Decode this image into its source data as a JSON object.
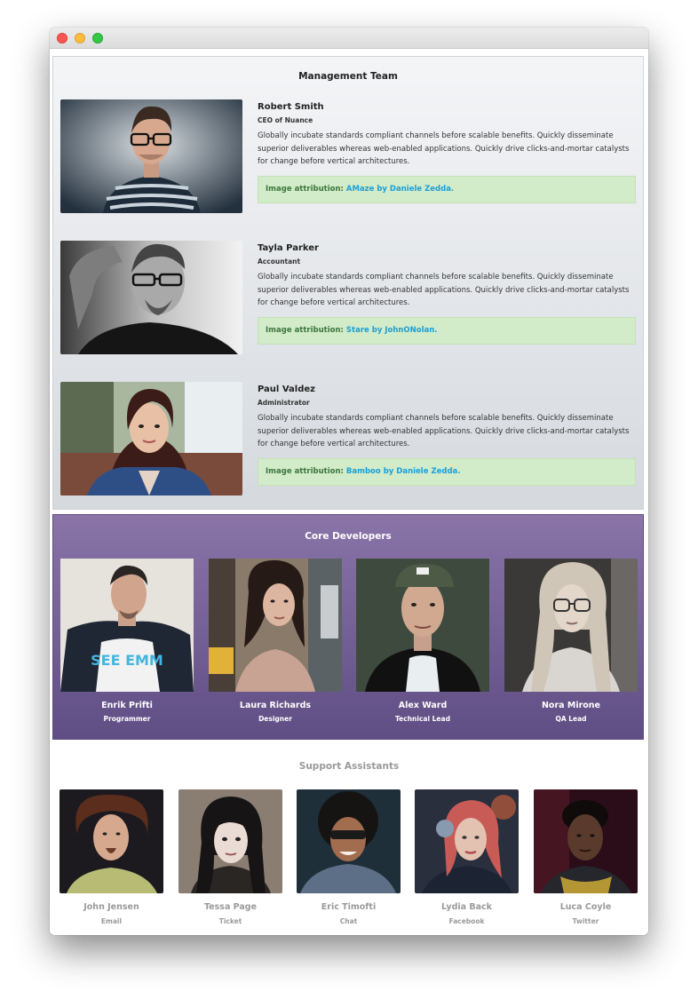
{
  "management": {
    "title": "Management Team",
    "members": [
      {
        "name": "Robert Smith",
        "role": "CEO of Nuance",
        "bio": "Globally incubate standards compliant channels before scalable benefits. Quickly disseminate superior deliverables whereas web-enabled applications. Quickly drive clicks-and-mortar catalysts for change before vertical architectures.",
        "attribution_label": "Image attribution:",
        "attribution_link": "AMaze by Daniele Zedda."
      },
      {
        "name": "Tayla Parker",
        "role": "Accountant",
        "bio": "Globally incubate standards compliant channels before scalable benefits. Quickly disseminate superior deliverables whereas web-enabled applications. Quickly drive clicks-and-mortar catalysts for change before vertical architectures.",
        "attribution_label": "Image attribution:",
        "attribution_link": "Stare by JohnONolan."
      },
      {
        "name": "Paul Valdez",
        "role": "Administrator",
        "bio": "Globally incubate standards compliant channels before scalable benefits. Quickly disseminate superior deliverables whereas web-enabled applications. Quickly drive clicks-and-mortar catalysts for change before vertical architectures.",
        "attribution_label": "Image attribution:",
        "attribution_link": "Bamboo by Daniele Zedda."
      }
    ]
  },
  "core": {
    "title": "Core Developers",
    "members": [
      {
        "name": "Enrik Prifti",
        "role": "Programmer",
        "shirt_text": "SEE EMM"
      },
      {
        "name": "Laura Richards",
        "role": "Designer"
      },
      {
        "name": "Alex Ward",
        "role": "Technical Lead"
      },
      {
        "name": "Nora Mirone",
        "role": "QA Lead"
      }
    ]
  },
  "support": {
    "title": "Support Assistants",
    "members": [
      {
        "name": "John Jensen",
        "role": "Email"
      },
      {
        "name": "Tessa Page",
        "role": "Ticket"
      },
      {
        "name": "Eric Timofti",
        "role": "Chat"
      },
      {
        "name": "Lydia Back",
        "role": "Facebook"
      },
      {
        "name": "Luca Coyle",
        "role": "Twitter"
      }
    ]
  },
  "colors": {
    "core_bg_top": "#8a74a8",
    "core_bg_bottom": "#5f4e84",
    "attribution_bg": "#d2ebc8",
    "link": "#1b9fd8",
    "attribution_text": "#3c763d"
  }
}
